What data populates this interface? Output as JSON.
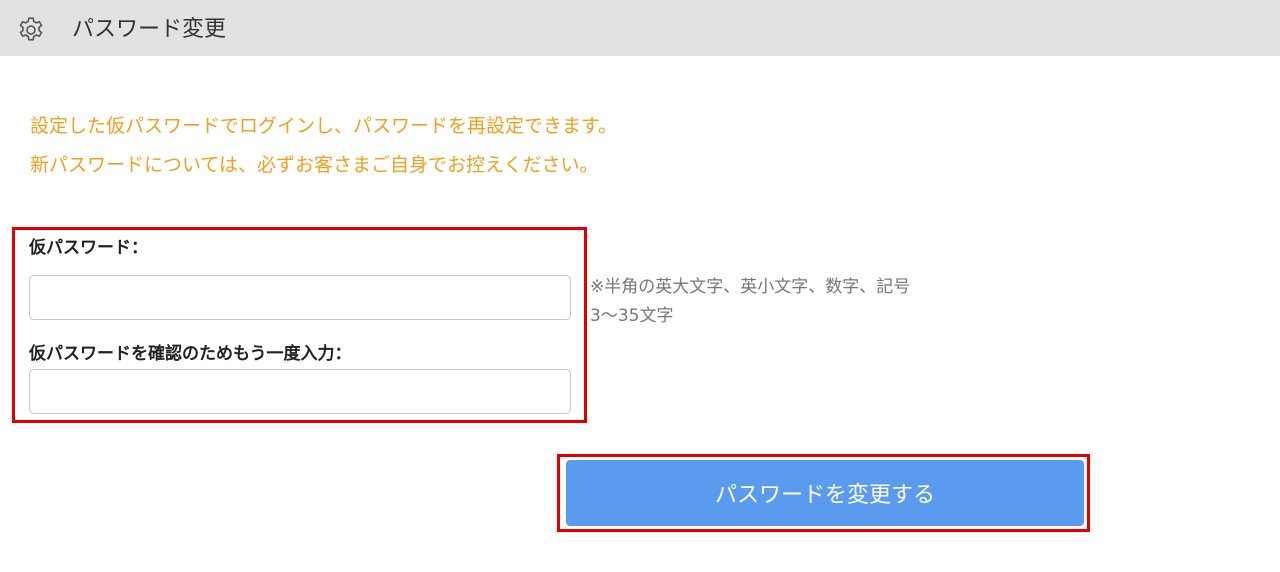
{
  "header": {
    "title": "パスワード変更",
    "icon": "gear-icon"
  },
  "notice": {
    "line1": "設定した仮パスワードでログインし、パスワードを再設定できます。",
    "line2": "新パスワードについては、必ずお客さまご自身でお控えください。",
    "color": "#f0a020"
  },
  "form": {
    "temp_password_label": "仮パスワード：",
    "temp_password_value": "",
    "confirm_password_label": "仮パスワードを確認のためもう一度入力：",
    "confirm_password_value": "",
    "hint_line1": "※半角の英大文字、英小文字、数字、記号",
    "hint_line2": "3〜35文字"
  },
  "submit": {
    "label": "パスワードを変更する",
    "color": "#5a9bf0"
  },
  "highlight_color": "#e00000"
}
